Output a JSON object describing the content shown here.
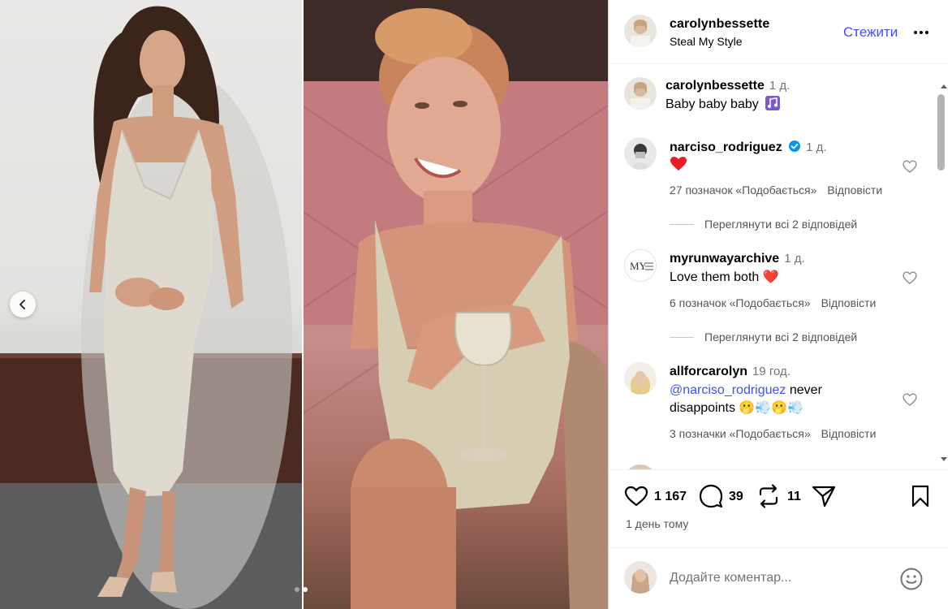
{
  "post": {
    "username": "carolynbessette",
    "subtitle": "Steal My Style",
    "follow_label": "Стежити",
    "caption": {
      "username": "carolynbessette",
      "time": "1 д.",
      "text": "Baby baby baby"
    },
    "likes": "1 167",
    "comments_count": "39",
    "reposts": "11",
    "time_ago": "1 день тому"
  },
  "comments": [
    {
      "username": "narciso_rodriguez",
      "verified": true,
      "time": "1 д.",
      "text": "❤️",
      "likes": "27 позначок «Подобається»",
      "reply": "Відповісти",
      "view_replies": "Переглянути всі 2 відповідей"
    },
    {
      "username": "myrunwayarchive",
      "time": "1 д.",
      "text": "Love them both ❤️",
      "likes": "6 позначок «Подобається»",
      "reply": "Відповісти",
      "view_replies": "Переглянути всі 2 відповідей"
    },
    {
      "username": "allforcarolyn",
      "time": "19 год.",
      "mention": "@narciso_rodriguez",
      "text_after": "never",
      "text_line2": "disappoints 🫢💨🫢💨",
      "likes": "3 позначки «Подобається»",
      "reply": "Відповісти"
    }
  ],
  "composer": {
    "placeholder": "Додайте коментар..."
  },
  "carousel": {
    "index": 2,
    "total": 2
  },
  "colors": {
    "link": "#4150f7",
    "like_red": "#ed1c24",
    "verified": "#0095f6"
  }
}
